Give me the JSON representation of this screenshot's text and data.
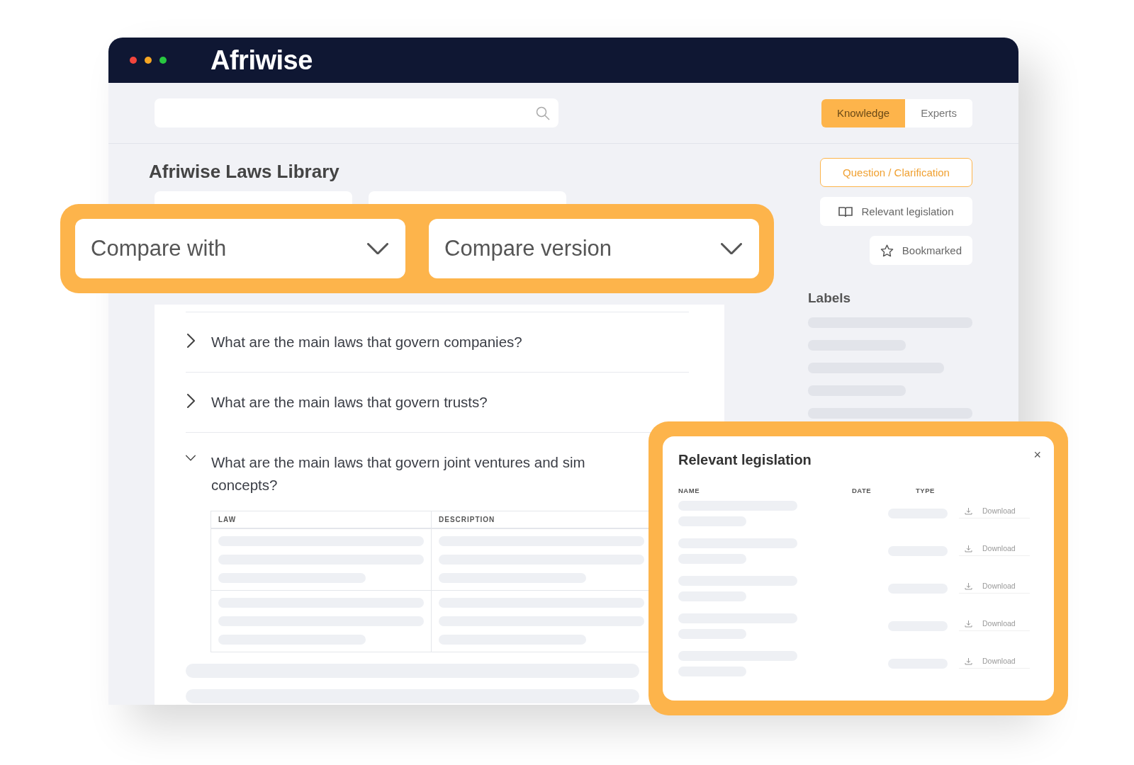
{
  "window": {
    "logo": "Afriwise"
  },
  "tabs": [
    {
      "label": "Knowledge",
      "selected": true
    },
    {
      "label": "Experts",
      "selected": false
    }
  ],
  "page_title": "Afriwise Laws Library",
  "compare_fields": [
    "Compare with",
    "Compare version"
  ],
  "questions": [
    {
      "lines": [
        "What are the main laws that govern companies?"
      ],
      "expanded": false
    },
    {
      "lines": [
        "What are the main laws that govern trusts?"
      ],
      "expanded": false
    },
    {
      "lines": [
        "What are the main laws that govern joint ventures and sim",
        "concepts?"
      ],
      "expanded": true,
      "table_columns": [
        "LAW",
        "DESCRIPTION"
      ]
    }
  ],
  "side_buttons": [
    {
      "label": "Question / Clarification",
      "kind": "primary"
    },
    {
      "label": "Relevant legislation",
      "kind": "book"
    },
    {
      "label": "Bookmarked",
      "kind": "star"
    }
  ],
  "labels_heading": "Labels",
  "modal": {
    "title": "Relevant legislation",
    "close": "×",
    "columns": [
      "NAME",
      "DATE",
      "TYPE"
    ],
    "rows": [
      {
        "action": "Download"
      },
      {
        "action": "Download"
      },
      {
        "action": "Download"
      },
      {
        "action": "Download"
      },
      {
        "action": "Download"
      }
    ]
  }
}
